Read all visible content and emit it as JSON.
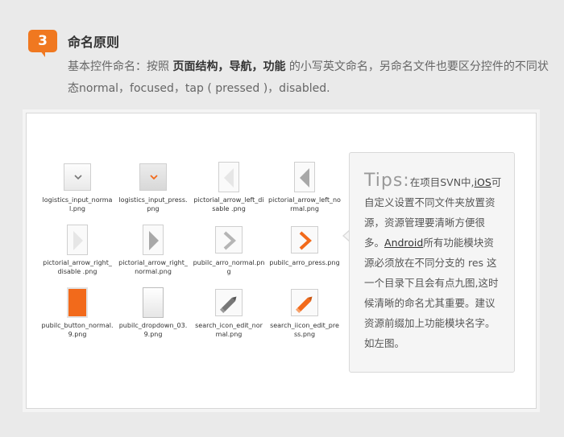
{
  "section": {
    "number": "3",
    "title": "命名原则",
    "desc_1": "基本控件命名：按照 ",
    "desc_bold": "页面结构，导航，功能",
    "desc_2": " 的小写英文命名，另命名文件也要区分控件的不同状态normal，focused，tap ( pressed )，disabled."
  },
  "files": [
    {
      "name": "logistics_input_normal.png",
      "icon": "chevron-down-gray-icon"
    },
    {
      "name": "logistics_input_press.png",
      "icon": "chevron-down-orange-icon"
    },
    {
      "name": "pictorial_arrow_left_disable .png",
      "icon": "arrow-left-disabled-icon"
    },
    {
      "name": "pictorial_arrow_left_normal.png",
      "icon": "arrow-left-normal-icon"
    },
    {
      "name": "pictorial_arrow_right_disable .png",
      "icon": "arrow-right-disabled-icon"
    },
    {
      "name": "pictorial_arrow_right_normal.png",
      "icon": "arrow-right-normal-icon"
    },
    {
      "name": "pubilc_arro_normal.png",
      "icon": "chevron-right-gray-icon"
    },
    {
      "name": "pubilc_arro_press.png",
      "icon": "chevron-right-orange-icon"
    },
    {
      "name": "pubilc_button_normal.9.png",
      "icon": "orange-button-icon"
    },
    {
      "name": "pubilc_dropdown_03.9.png",
      "icon": "dropdown-box-icon"
    },
    {
      "name": "search_icon_edit_normal.png",
      "icon": "pencil-gray-icon"
    },
    {
      "name": "search_iicon_edit_press.png",
      "icon": "pencil-orange-icon"
    }
  ],
  "tips": {
    "heading": "Tips:",
    "t1": "在项目SVN中,",
    "ios": "iOS",
    "t2": "可自定义设置不同文件夹放置资源，资源管理要清晰方便很多。",
    "android": "Android",
    "t3": "所有功能模块资源必须放在不同分支的 res 这一个目录下且会有点九图,这时候清晰的命名尤其重要。建议资源前缀加上功能模块名字。如左图。"
  },
  "colors": {
    "accent": "#f07820"
  }
}
